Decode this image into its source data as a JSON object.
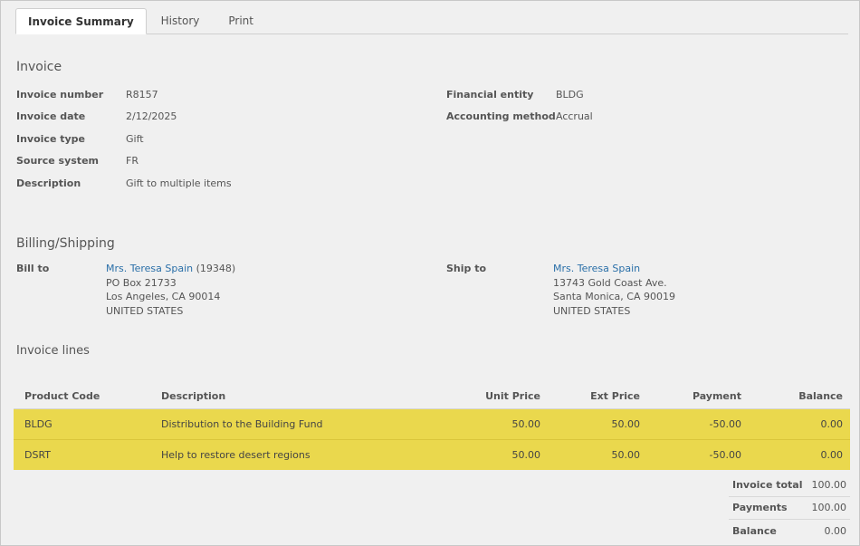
{
  "tabs": [
    {
      "label": "Invoice Summary",
      "active": true
    },
    {
      "label": "History"
    },
    {
      "label": "Print"
    }
  ],
  "invoice": {
    "title": "Invoice",
    "fields_left": [
      {
        "label": "Invoice number",
        "value": "R8157"
      },
      {
        "label": "Invoice date",
        "value": "2/12/2025"
      },
      {
        "label": "Invoice type",
        "value": "Gift"
      },
      {
        "label": "Source system",
        "value": "FR"
      },
      {
        "label": "Description",
        "value": "Gift to multiple items"
      }
    ],
    "fields_right": [
      {
        "label": "Financial entity",
        "value": "BLDG"
      },
      {
        "label": "Accounting method",
        "value": "Accrual"
      }
    ]
  },
  "billing": {
    "title": "Billing/Shipping",
    "bill_to": {
      "label": "Bill to",
      "name": "Mrs. Teresa Spain",
      "id": "(19348)",
      "line1": "PO Box 21733",
      "line2": "Los Angeles, CA 90014",
      "line3": "UNITED STATES"
    },
    "ship_to": {
      "label": "Ship to",
      "name": "Mrs. Teresa Spain",
      "line1": "13743 Gold Coast Ave.",
      "line2": "Santa Monica, CA 90019",
      "line3": "UNITED STATES"
    }
  },
  "lines": {
    "title": "Invoice lines",
    "columns": [
      "Product Code",
      "Description",
      "Unit Price",
      "Ext Price",
      "Payment",
      "Balance"
    ],
    "rows": [
      {
        "code": "BLDG",
        "description": "Distribution to the Building Fund",
        "unit_price": "50.00",
        "ext_price": "50.00",
        "payment": "-50.00",
        "balance": "0.00"
      },
      {
        "code": "DSRT",
        "description": "Help to restore desert regions",
        "unit_price": "50.00",
        "ext_price": "50.00",
        "payment": "-50.00",
        "balance": "0.00"
      }
    ],
    "highlight_color": "#ead84d"
  },
  "totals": [
    {
      "label": "Invoice total",
      "value": "100.00"
    },
    {
      "label": "Payments",
      "value": "100.00"
    },
    {
      "label": "Balance",
      "value": "0.00"
    }
  ],
  "colors": {
    "link": "#2a6fa8"
  }
}
